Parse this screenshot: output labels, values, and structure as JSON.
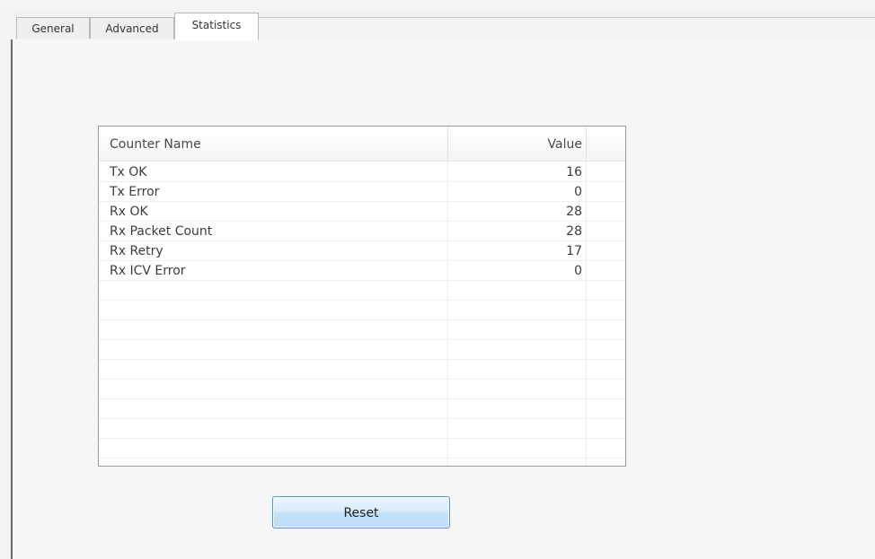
{
  "tabs": [
    {
      "label": "General"
    },
    {
      "label": "Advanced"
    },
    {
      "label": "Statistics",
      "active": true
    }
  ],
  "table": {
    "columns": [
      "Counter Name",
      "Value"
    ],
    "rows": [
      {
        "name": "Tx OK",
        "value": "16"
      },
      {
        "name": "Tx Error",
        "value": "0"
      },
      {
        "name": "Rx OK",
        "value": "28"
      },
      {
        "name": "Rx Packet Count",
        "value": "28"
      },
      {
        "name": "Rx Retry",
        "value": "17"
      },
      {
        "name": "Rx ICV Error",
        "value": "0"
      }
    ]
  },
  "reset_button": {
    "label": "Reset"
  },
  "colors": {
    "button_border": "#5f8fc0",
    "button_fill": "#c2e0f8",
    "panel_border": "#6a6a6a"
  }
}
